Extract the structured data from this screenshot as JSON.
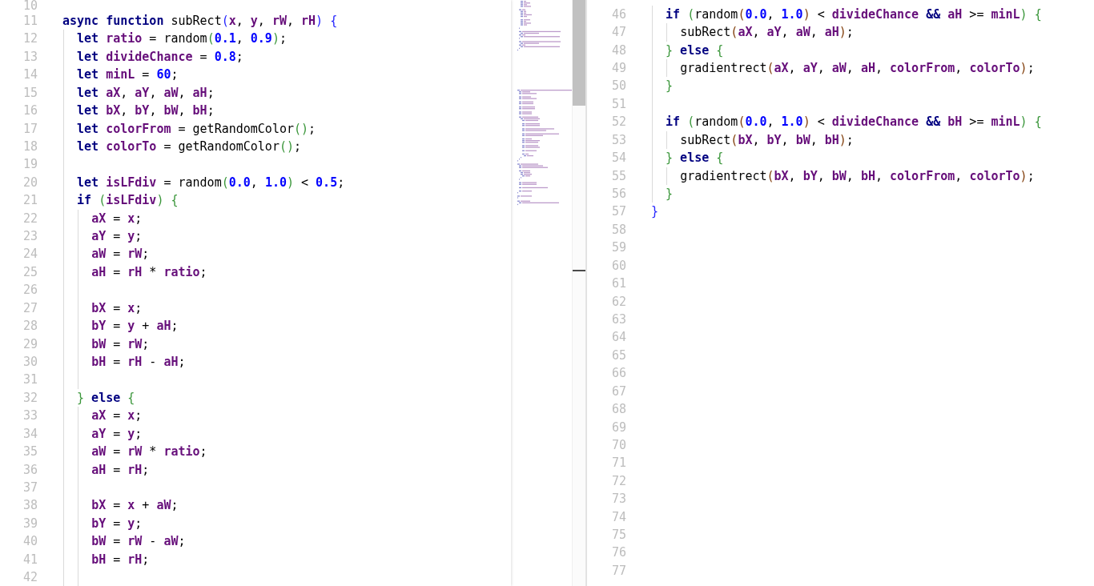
{
  "panes": [
    {
      "lines": [
        {
          "number": "10"
        },
        {
          "number": "11",
          "tokens": [
            {
              "text": "async function",
              "kind": "keyword"
            },
            {
              "text": " subRect",
              "kind": "plain"
            },
            {
              "text": "(",
              "kind": "bracket",
              "color": "#2525ff"
            },
            {
              "text": "x",
              "kind": "variable"
            },
            {
              "text": ", ",
              "kind": "plain"
            },
            {
              "text": "y",
              "kind": "variable"
            },
            {
              "text": ", ",
              "kind": "plain"
            },
            {
              "text": "rW",
              "kind": "variable"
            },
            {
              "text": ", ",
              "kind": "plain"
            },
            {
              "text": "rH",
              "kind": "variable"
            },
            {
              "text": ") {",
              "kind": "bracket",
              "color": "#2525ff"
            }
          ]
        },
        {
          "number": "12",
          "tokens": [
            {
              "text": "  let",
              "kind": "keyword"
            },
            {
              "text": " ratio",
              "kind": "variable"
            },
            {
              "text": " = random",
              "kind": "plain"
            },
            {
              "text": "(",
              "kind": "bracket",
              "color": "#3a963a"
            },
            {
              "text": "0.1",
              "kind": "number"
            },
            {
              "text": ", ",
              "kind": "plain"
            },
            {
              "text": "0.9",
              "kind": "number"
            },
            {
              "text": ")",
              "kind": "bracket",
              "color": "#3a963a"
            },
            {
              "text": ";",
              "kind": "plain"
            }
          ]
        },
        {
          "number": "13",
          "tokens": [
            {
              "text": "  let",
              "kind": "keyword"
            },
            {
              "text": " divideChance",
              "kind": "variable"
            },
            {
              "text": " = ",
              "kind": "plain"
            },
            {
              "text": "0.8",
              "kind": "number"
            },
            {
              "text": ";",
              "kind": "plain"
            }
          ]
        },
        {
          "number": "14",
          "tokens": [
            {
              "text": "  let",
              "kind": "keyword"
            },
            {
              "text": " minL",
              "kind": "variable"
            },
            {
              "text": " = ",
              "kind": "plain"
            },
            {
              "text": "60",
              "kind": "number"
            },
            {
              "text": ";",
              "kind": "plain"
            }
          ]
        },
        {
          "number": "15",
          "tokens": [
            {
              "text": "  let",
              "kind": "keyword"
            },
            {
              "text": " aX",
              "kind": "variable"
            },
            {
              "text": ", ",
              "kind": "plain"
            },
            {
              "text": "aY",
              "kind": "variable"
            },
            {
              "text": ", ",
              "kind": "plain"
            },
            {
              "text": "aW",
              "kind": "variable"
            },
            {
              "text": ", ",
              "kind": "plain"
            },
            {
              "text": "aH",
              "kind": "variable"
            },
            {
              "text": ";",
              "kind": "plain"
            }
          ]
        },
        {
          "number": "16",
          "tokens": [
            {
              "text": "  let",
              "kind": "keyword"
            },
            {
              "text": " bX",
              "kind": "variable"
            },
            {
              "text": ", ",
              "kind": "plain"
            },
            {
              "text": "bY",
              "kind": "variable"
            },
            {
              "text": ", ",
              "kind": "plain"
            },
            {
              "text": "bW",
              "kind": "variable"
            },
            {
              "text": ", ",
              "kind": "plain"
            },
            {
              "text": "bH",
              "kind": "variable"
            },
            {
              "text": ";",
              "kind": "plain"
            }
          ]
        },
        {
          "number": "17",
          "tokens": [
            {
              "text": "  let",
              "kind": "keyword"
            },
            {
              "text": " colorFrom",
              "kind": "variable"
            },
            {
              "text": " = getRandomColor",
              "kind": "plain"
            },
            {
              "text": "()",
              "kind": "bracket",
              "color": "#3a963a"
            },
            {
              "text": ";",
              "kind": "plain"
            }
          ]
        },
        {
          "number": "18",
          "tokens": [
            {
              "text": "  let",
              "kind": "keyword"
            },
            {
              "text": " colorTo",
              "kind": "variable"
            },
            {
              "text": " = getRandomColor",
              "kind": "plain"
            },
            {
              "text": "()",
              "kind": "bracket",
              "color": "#3a963a"
            },
            {
              "text": ";",
              "kind": "plain"
            }
          ]
        },
        {
          "number": "19"
        },
        {
          "number": "20",
          "tokens": [
            {
              "text": "  let",
              "kind": "keyword"
            },
            {
              "text": " isLFdiv",
              "kind": "variable"
            },
            {
              "text": " = random",
              "kind": "plain"
            },
            {
              "text": "(",
              "kind": "bracket",
              "color": "#3a963a"
            },
            {
              "text": "0.0",
              "kind": "number"
            },
            {
              "text": ", ",
              "kind": "plain"
            },
            {
              "text": "1.0",
              "kind": "number"
            },
            {
              "text": ")",
              "kind": "bracket",
              "color": "#3a963a"
            },
            {
              "text": " < ",
              "kind": "plain"
            },
            {
              "text": "0.5",
              "kind": "number"
            },
            {
              "text": ";",
              "kind": "plain"
            }
          ]
        },
        {
          "number": "21",
          "tokens": [
            {
              "text": "  if",
              "kind": "keyword"
            },
            {
              "text": " (",
              "kind": "bracket",
              "color": "#3a963a"
            },
            {
              "text": "isLFdiv",
              "kind": "variable"
            },
            {
              "text": ") {",
              "kind": "bracket",
              "color": "#3a963a"
            }
          ]
        },
        {
          "number": "22",
          "tokens": [
            {
              "text": "    aX",
              "kind": "variable"
            },
            {
              "text": " = ",
              "kind": "plain"
            },
            {
              "text": "x",
              "kind": "variable"
            },
            {
              "text": ";",
              "kind": "plain"
            }
          ]
        },
        {
          "number": "23",
          "tokens": [
            {
              "text": "    aY",
              "kind": "variable"
            },
            {
              "text": " = ",
              "kind": "plain"
            },
            {
              "text": "y",
              "kind": "variable"
            },
            {
              "text": ";",
              "kind": "plain"
            }
          ]
        },
        {
          "number": "24",
          "tokens": [
            {
              "text": "    aW",
              "kind": "variable"
            },
            {
              "text": " = ",
              "kind": "plain"
            },
            {
              "text": "rW",
              "kind": "variable"
            },
            {
              "text": ";",
              "kind": "plain"
            }
          ]
        },
        {
          "number": "25",
          "tokens": [
            {
              "text": "    aH",
              "kind": "variable"
            },
            {
              "text": " = ",
              "kind": "plain"
            },
            {
              "text": "rH",
              "kind": "variable"
            },
            {
              "text": " * ",
              "kind": "plain"
            },
            {
              "text": "ratio",
              "kind": "variable"
            },
            {
              "text": ";",
              "kind": "plain"
            }
          ]
        },
        {
          "number": "26"
        },
        {
          "number": "27",
          "tokens": [
            {
              "text": "    bX",
              "kind": "variable"
            },
            {
              "text": " = ",
              "kind": "plain"
            },
            {
              "text": "x",
              "kind": "variable"
            },
            {
              "text": ";",
              "kind": "plain"
            }
          ]
        },
        {
          "number": "28",
          "tokens": [
            {
              "text": "    bY",
              "kind": "variable"
            },
            {
              "text": " = ",
              "kind": "plain"
            },
            {
              "text": "y",
              "kind": "variable"
            },
            {
              "text": " + ",
              "kind": "plain"
            },
            {
              "text": "aH",
              "kind": "variable"
            },
            {
              "text": ";",
              "kind": "plain"
            }
          ]
        },
        {
          "number": "29",
          "tokens": [
            {
              "text": "    bW",
              "kind": "variable"
            },
            {
              "text": " = ",
              "kind": "plain"
            },
            {
              "text": "rW",
              "kind": "variable"
            },
            {
              "text": ";",
              "kind": "plain"
            }
          ]
        },
        {
          "number": "30",
          "tokens": [
            {
              "text": "    bH",
              "kind": "variable"
            },
            {
              "text": " = ",
              "kind": "plain"
            },
            {
              "text": "rH",
              "kind": "variable"
            },
            {
              "text": " - ",
              "kind": "plain"
            },
            {
              "text": "aH",
              "kind": "variable"
            },
            {
              "text": ";",
              "kind": "plain"
            }
          ]
        },
        {
          "number": "31"
        },
        {
          "number": "32",
          "tokens": [
            {
              "text": "  }",
              "kind": "bracket",
              "color": "#3a963a"
            },
            {
              "text": " else",
              "kind": "keyword"
            },
            {
              "text": " {",
              "kind": "bracket",
              "color": "#3a963a"
            }
          ]
        },
        {
          "number": "33",
          "tokens": [
            {
              "text": "    aX",
              "kind": "variable"
            },
            {
              "text": " = ",
              "kind": "plain"
            },
            {
              "text": "x",
              "kind": "variable"
            },
            {
              "text": ";",
              "kind": "plain"
            }
          ]
        },
        {
          "number": "34",
          "tokens": [
            {
              "text": "    aY",
              "kind": "variable"
            },
            {
              "text": " = ",
              "kind": "plain"
            },
            {
              "text": "y",
              "kind": "variable"
            },
            {
              "text": ";",
              "kind": "plain"
            }
          ]
        },
        {
          "number": "35",
          "tokens": [
            {
              "text": "    aW",
              "kind": "variable"
            },
            {
              "text": " = ",
              "kind": "plain"
            },
            {
              "text": "rW",
              "kind": "variable"
            },
            {
              "text": " * ",
              "kind": "plain"
            },
            {
              "text": "ratio",
              "kind": "variable"
            },
            {
              "text": ";",
              "kind": "plain"
            }
          ]
        },
        {
          "number": "36",
          "tokens": [
            {
              "text": "    aH",
              "kind": "variable"
            },
            {
              "text": " = ",
              "kind": "plain"
            },
            {
              "text": "rH",
              "kind": "variable"
            },
            {
              "text": ";",
              "kind": "plain"
            }
          ]
        },
        {
          "number": "37"
        },
        {
          "number": "38",
          "tokens": [
            {
              "text": "    bX",
              "kind": "variable"
            },
            {
              "text": " = ",
              "kind": "plain"
            },
            {
              "text": "x",
              "kind": "variable"
            },
            {
              "text": " + ",
              "kind": "plain"
            },
            {
              "text": "aW",
              "kind": "variable"
            },
            {
              "text": ";",
              "kind": "plain"
            }
          ]
        },
        {
          "number": "39",
          "tokens": [
            {
              "text": "    bY",
              "kind": "variable"
            },
            {
              "text": " = ",
              "kind": "plain"
            },
            {
              "text": "y",
              "kind": "variable"
            },
            {
              "text": ";",
              "kind": "plain"
            }
          ]
        },
        {
          "number": "40",
          "tokens": [
            {
              "text": "    bW",
              "kind": "variable"
            },
            {
              "text": " = ",
              "kind": "plain"
            },
            {
              "text": "rW",
              "kind": "variable"
            },
            {
              "text": " - ",
              "kind": "plain"
            },
            {
              "text": "aW",
              "kind": "variable"
            },
            {
              "text": ";",
              "kind": "plain"
            }
          ]
        },
        {
          "number": "41",
          "tokens": [
            {
              "text": "    bH",
              "kind": "variable"
            },
            {
              "text": " = ",
              "kind": "plain"
            },
            {
              "text": "rH",
              "kind": "variable"
            },
            {
              "text": ";",
              "kind": "plain"
            }
          ]
        },
        {
          "number": "42"
        }
      ]
    },
    {
      "lines": [
        {
          "number": "46",
          "tokens": [
            {
              "text": "  if",
              "kind": "keyword"
            },
            {
              "text": " (",
              "kind": "bracket",
              "color": "#3a963a"
            },
            {
              "text": "random",
              "kind": "plain"
            },
            {
              "text": "(",
              "kind": "bracket",
              "color": "#83410f"
            },
            {
              "text": "0.0",
              "kind": "number"
            },
            {
              "text": ", ",
              "kind": "plain"
            },
            {
              "text": "1.0",
              "kind": "number"
            },
            {
              "text": ")",
              "kind": "bracket",
              "color": "#83410f"
            },
            {
              "text": " < ",
              "kind": "plain"
            },
            {
              "text": "divideChance",
              "kind": "variable"
            },
            {
              "text": " &&",
              "kind": "keyword"
            },
            {
              "text": " aH",
              "kind": "variable"
            },
            {
              "text": " >= ",
              "kind": "plain"
            },
            {
              "text": "minL",
              "kind": "variable"
            },
            {
              "text": ") {",
              "kind": "bracket",
              "color": "#3a963a"
            }
          ]
        },
        {
          "number": "47",
          "tokens": [
            {
              "text": "    subRect",
              "kind": "plain"
            },
            {
              "text": "(",
              "kind": "bracket",
              "color": "#83410f"
            },
            {
              "text": "aX",
              "kind": "variable"
            },
            {
              "text": ", ",
              "kind": "plain"
            },
            {
              "text": "aY",
              "kind": "variable"
            },
            {
              "text": ", ",
              "kind": "plain"
            },
            {
              "text": "aW",
              "kind": "variable"
            },
            {
              "text": ", ",
              "kind": "plain"
            },
            {
              "text": "aH",
              "kind": "variable"
            },
            {
              "text": ")",
              "kind": "bracket",
              "color": "#83410f"
            },
            {
              "text": ";",
              "kind": "plain"
            }
          ]
        },
        {
          "number": "48",
          "tokens": [
            {
              "text": "  }",
              "kind": "bracket",
              "color": "#3a963a"
            },
            {
              "text": " else",
              "kind": "keyword"
            },
            {
              "text": " {",
              "kind": "bracket",
              "color": "#3a963a"
            }
          ]
        },
        {
          "number": "49",
          "tokens": [
            {
              "text": "    gradientrect",
              "kind": "plain"
            },
            {
              "text": "(",
              "kind": "bracket",
              "color": "#83410f"
            },
            {
              "text": "aX",
              "kind": "variable"
            },
            {
              "text": ", ",
              "kind": "plain"
            },
            {
              "text": "aY",
              "kind": "variable"
            },
            {
              "text": ", ",
              "kind": "plain"
            },
            {
              "text": "aW",
              "kind": "variable"
            },
            {
              "text": ", ",
              "kind": "plain"
            },
            {
              "text": "aH",
              "kind": "variable"
            },
            {
              "text": ", ",
              "kind": "plain"
            },
            {
              "text": "colorFrom",
              "kind": "variable"
            },
            {
              "text": ", ",
              "kind": "plain"
            },
            {
              "text": "colorTo",
              "kind": "variable"
            },
            {
              "text": ")",
              "kind": "bracket",
              "color": "#83410f"
            },
            {
              "text": ";",
              "kind": "plain"
            }
          ]
        },
        {
          "number": "50",
          "tokens": [
            {
              "text": "  }",
              "kind": "bracket",
              "color": "#3a963a"
            }
          ]
        },
        {
          "number": "51"
        },
        {
          "number": "52",
          "tokens": [
            {
              "text": "  if",
              "kind": "keyword"
            },
            {
              "text": " (",
              "kind": "bracket",
              "color": "#3a963a"
            },
            {
              "text": "random",
              "kind": "plain"
            },
            {
              "text": "(",
              "kind": "bracket",
              "color": "#83410f"
            },
            {
              "text": "0.0",
              "kind": "number"
            },
            {
              "text": ", ",
              "kind": "plain"
            },
            {
              "text": "1.0",
              "kind": "number"
            },
            {
              "text": ")",
              "kind": "bracket",
              "color": "#83410f"
            },
            {
              "text": " < ",
              "kind": "plain"
            },
            {
              "text": "divideChance",
              "kind": "variable"
            },
            {
              "text": " &&",
              "kind": "keyword"
            },
            {
              "text": " bH",
              "kind": "variable"
            },
            {
              "text": " >= ",
              "kind": "plain"
            },
            {
              "text": "minL",
              "kind": "variable"
            },
            {
              "text": ") {",
              "kind": "bracket",
              "color": "#3a963a"
            }
          ]
        },
        {
          "number": "53",
          "tokens": [
            {
              "text": "    subRect",
              "kind": "plain"
            },
            {
              "text": "(",
              "kind": "bracket",
              "color": "#83410f"
            },
            {
              "text": "bX",
              "kind": "variable"
            },
            {
              "text": ", ",
              "kind": "plain"
            },
            {
              "text": "bY",
              "kind": "variable"
            },
            {
              "text": ", ",
              "kind": "plain"
            },
            {
              "text": "bW",
              "kind": "variable"
            },
            {
              "text": ", ",
              "kind": "plain"
            },
            {
              "text": "bH",
              "kind": "variable"
            },
            {
              "text": ")",
              "kind": "bracket",
              "color": "#83410f"
            },
            {
              "text": ";",
              "kind": "plain"
            }
          ]
        },
        {
          "number": "54",
          "tokens": [
            {
              "text": "  }",
              "kind": "bracket",
              "color": "#3a963a"
            },
            {
              "text": " else",
              "kind": "keyword"
            },
            {
              "text": " {",
              "kind": "bracket",
              "color": "#3a963a"
            }
          ]
        },
        {
          "number": "55",
          "tokens": [
            {
              "text": "    gradientrect",
              "kind": "plain"
            },
            {
              "text": "(",
              "kind": "bracket",
              "color": "#83410f"
            },
            {
              "text": "bX",
              "kind": "variable"
            },
            {
              "text": ", ",
              "kind": "plain"
            },
            {
              "text": "bY",
              "kind": "variable"
            },
            {
              "text": ", ",
              "kind": "plain"
            },
            {
              "text": "bW",
              "kind": "variable"
            },
            {
              "text": ", ",
              "kind": "plain"
            },
            {
              "text": "bH",
              "kind": "variable"
            },
            {
              "text": ", ",
              "kind": "plain"
            },
            {
              "text": "colorFrom",
              "kind": "variable"
            },
            {
              "text": ", ",
              "kind": "plain"
            },
            {
              "text": "colorTo",
              "kind": "variable"
            },
            {
              "text": ")",
              "kind": "bracket",
              "color": "#83410f"
            },
            {
              "text": ";",
              "kind": "plain"
            }
          ]
        },
        {
          "number": "56",
          "tokens": [
            {
              "text": "  }",
              "kind": "bracket",
              "color": "#3a963a"
            }
          ]
        },
        {
          "number": "57",
          "tokens": [
            {
              "text": "}",
              "kind": "bracket",
              "color": "#2525ff"
            }
          ]
        },
        {
          "number": "58"
        },
        {
          "number": "59"
        },
        {
          "number": "60"
        },
        {
          "number": "61"
        },
        {
          "number": "62"
        },
        {
          "number": "63"
        },
        {
          "number": "64"
        },
        {
          "number": "65"
        },
        {
          "number": "66"
        },
        {
          "number": "67"
        },
        {
          "number": "68"
        },
        {
          "number": "69"
        },
        {
          "number": "70"
        },
        {
          "number": "71"
        },
        {
          "number": "72"
        },
        {
          "number": "73"
        },
        {
          "number": "74"
        },
        {
          "number": "75"
        },
        {
          "number": "76"
        },
        {
          "number": "77"
        }
      ]
    }
  ]
}
